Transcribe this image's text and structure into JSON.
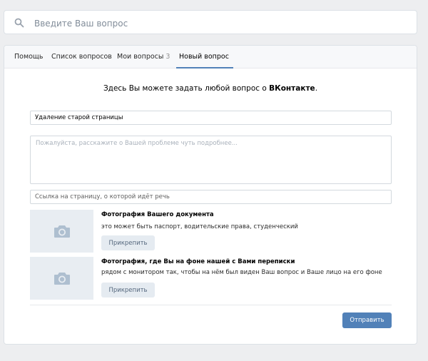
{
  "search": {
    "placeholder": "Введите Ваш вопрос",
    "icon": "search-icon"
  },
  "tabs": [
    {
      "label": "Помощь",
      "active": false
    },
    {
      "label": "Список вопросов",
      "active": false
    },
    {
      "label": "Мои вопросы",
      "count": "3",
      "active": false
    },
    {
      "label": "Новый вопрос",
      "active": true
    }
  ],
  "intro": {
    "text": "Здесь Вы можете задать любой вопрос о ",
    "brand": "ВКонтакте",
    "suffix": "."
  },
  "form": {
    "subject_value": "Удаление старой страницы",
    "description_placeholder": "Пожалуйста, расскажите о Вашей проблеме чуть подробнее...",
    "link_placeholder": "Ссылка на страницу, о которой идёт речь"
  },
  "attachments": [
    {
      "title": "Фотография Вашего документа",
      "description": "это может быть паспорт, водительские права, студенческий",
      "button_label": "Прикрепить",
      "icon": "camera-icon"
    },
    {
      "title": "Фотография, где Вы на фоне нашей с Вами переписки",
      "description": "рядом с монитором так, чтобы на нём был виден Ваш вопрос и Ваше лицо на его фоне",
      "button_label": "Прикрепить",
      "icon": "camera-icon"
    }
  ],
  "submit_label": "Отправить",
  "colors": {
    "accent": "#5181b8",
    "background": "#edeef0",
    "secondary_button": "#e5ebf1"
  }
}
